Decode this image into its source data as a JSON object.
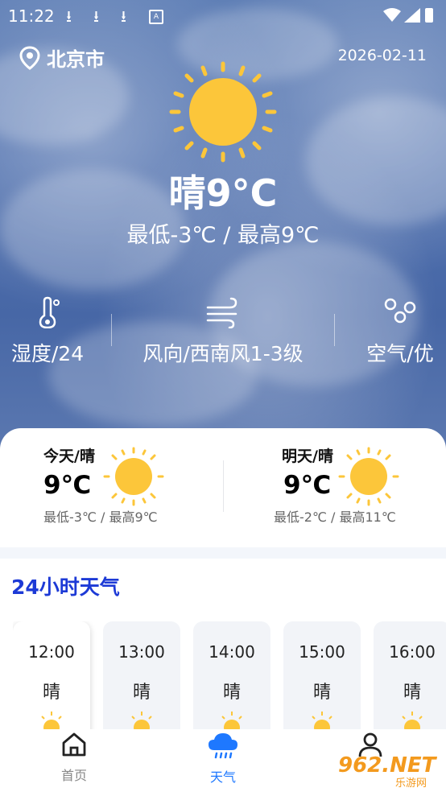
{
  "status_bar": {
    "time": "11:22"
  },
  "header": {
    "city": "北京市",
    "date": "2026-02-11"
  },
  "current": {
    "condition_temp": "晴9°C",
    "range": "最低-3℃  /  最高9℃"
  },
  "metrics": [
    {
      "icon": "thermometer-icon",
      "label": "湿度/24"
    },
    {
      "icon": "wind-icon",
      "label": "风向/西南风1-3级"
    },
    {
      "icon": "air-quality-icon",
      "label": "空气/优"
    }
  ],
  "days": [
    {
      "title": "今天/晴",
      "temp": "9℃",
      "range": "最低-3℃ / 最高9℃"
    },
    {
      "title": "明天/晴",
      "temp": "9℃",
      "range": "最低-2℃ / 最高11℃"
    }
  ],
  "hourly": {
    "title": "24小时天气",
    "items": [
      {
        "time": "12:00",
        "weather": "晴"
      },
      {
        "time": "13:00",
        "weather": "晴"
      },
      {
        "time": "14:00",
        "weather": "晴"
      },
      {
        "time": "15:00",
        "weather": "晴"
      },
      {
        "time": "16:00",
        "weather": "晴"
      }
    ]
  },
  "nav": [
    {
      "label": "首页",
      "icon": "home-icon"
    },
    {
      "label": "天气",
      "icon": "cloud-rain-icon"
    },
    {
      "label": "",
      "icon": "user-icon"
    }
  ],
  "watermark": {
    "text": "962.NET",
    "sub": "乐游网"
  },
  "colors": {
    "sun": "#fcc63a",
    "accent": "#1d3ad6",
    "nav_active": "#1e78ff",
    "nav_inactive": "#888888"
  }
}
